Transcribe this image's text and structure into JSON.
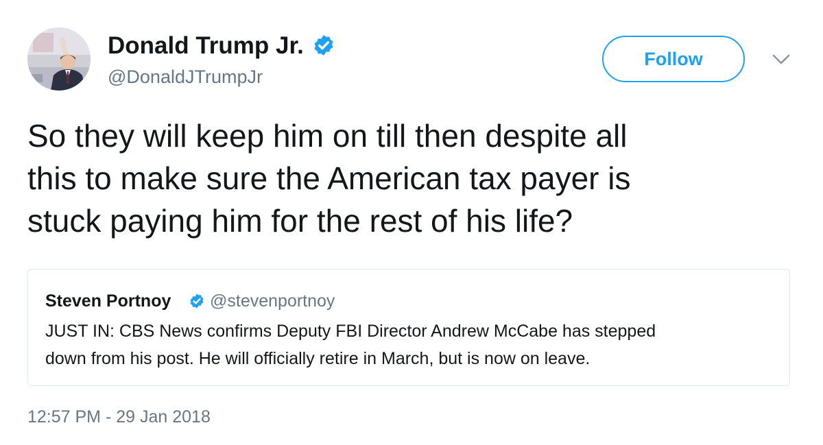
{
  "author": {
    "name": "Donald Trump Jr.",
    "handle": "@DonaldJTrumpJr",
    "verified": true,
    "avatar_icon": "profile-photo"
  },
  "actions": {
    "follow_label": "Follow",
    "more_icon": "chevron-down-icon"
  },
  "tweet": {
    "lines": [
      "So they will keep him on till then despite all",
      "this to make sure the American tax payer is",
      "stuck paying him for the rest of his life?"
    ],
    "timestamp": "12:57 PM - 29 Jan 2018"
  },
  "quoted_tweet": {
    "author_name": "Steven Portnoy",
    "handle": "@stevenportnoy",
    "verified": true,
    "lines": [
      "JUST IN: CBS News confirms Deputy FBI Director Andrew McCabe has stepped",
      "down from his post. He will officially retire in March, but is now on leave."
    ]
  },
  "colors": {
    "brand_blue": "#1da1f2",
    "text_primary": "#14171a",
    "text_secondary": "#657786",
    "border": "#e1e8ed"
  }
}
